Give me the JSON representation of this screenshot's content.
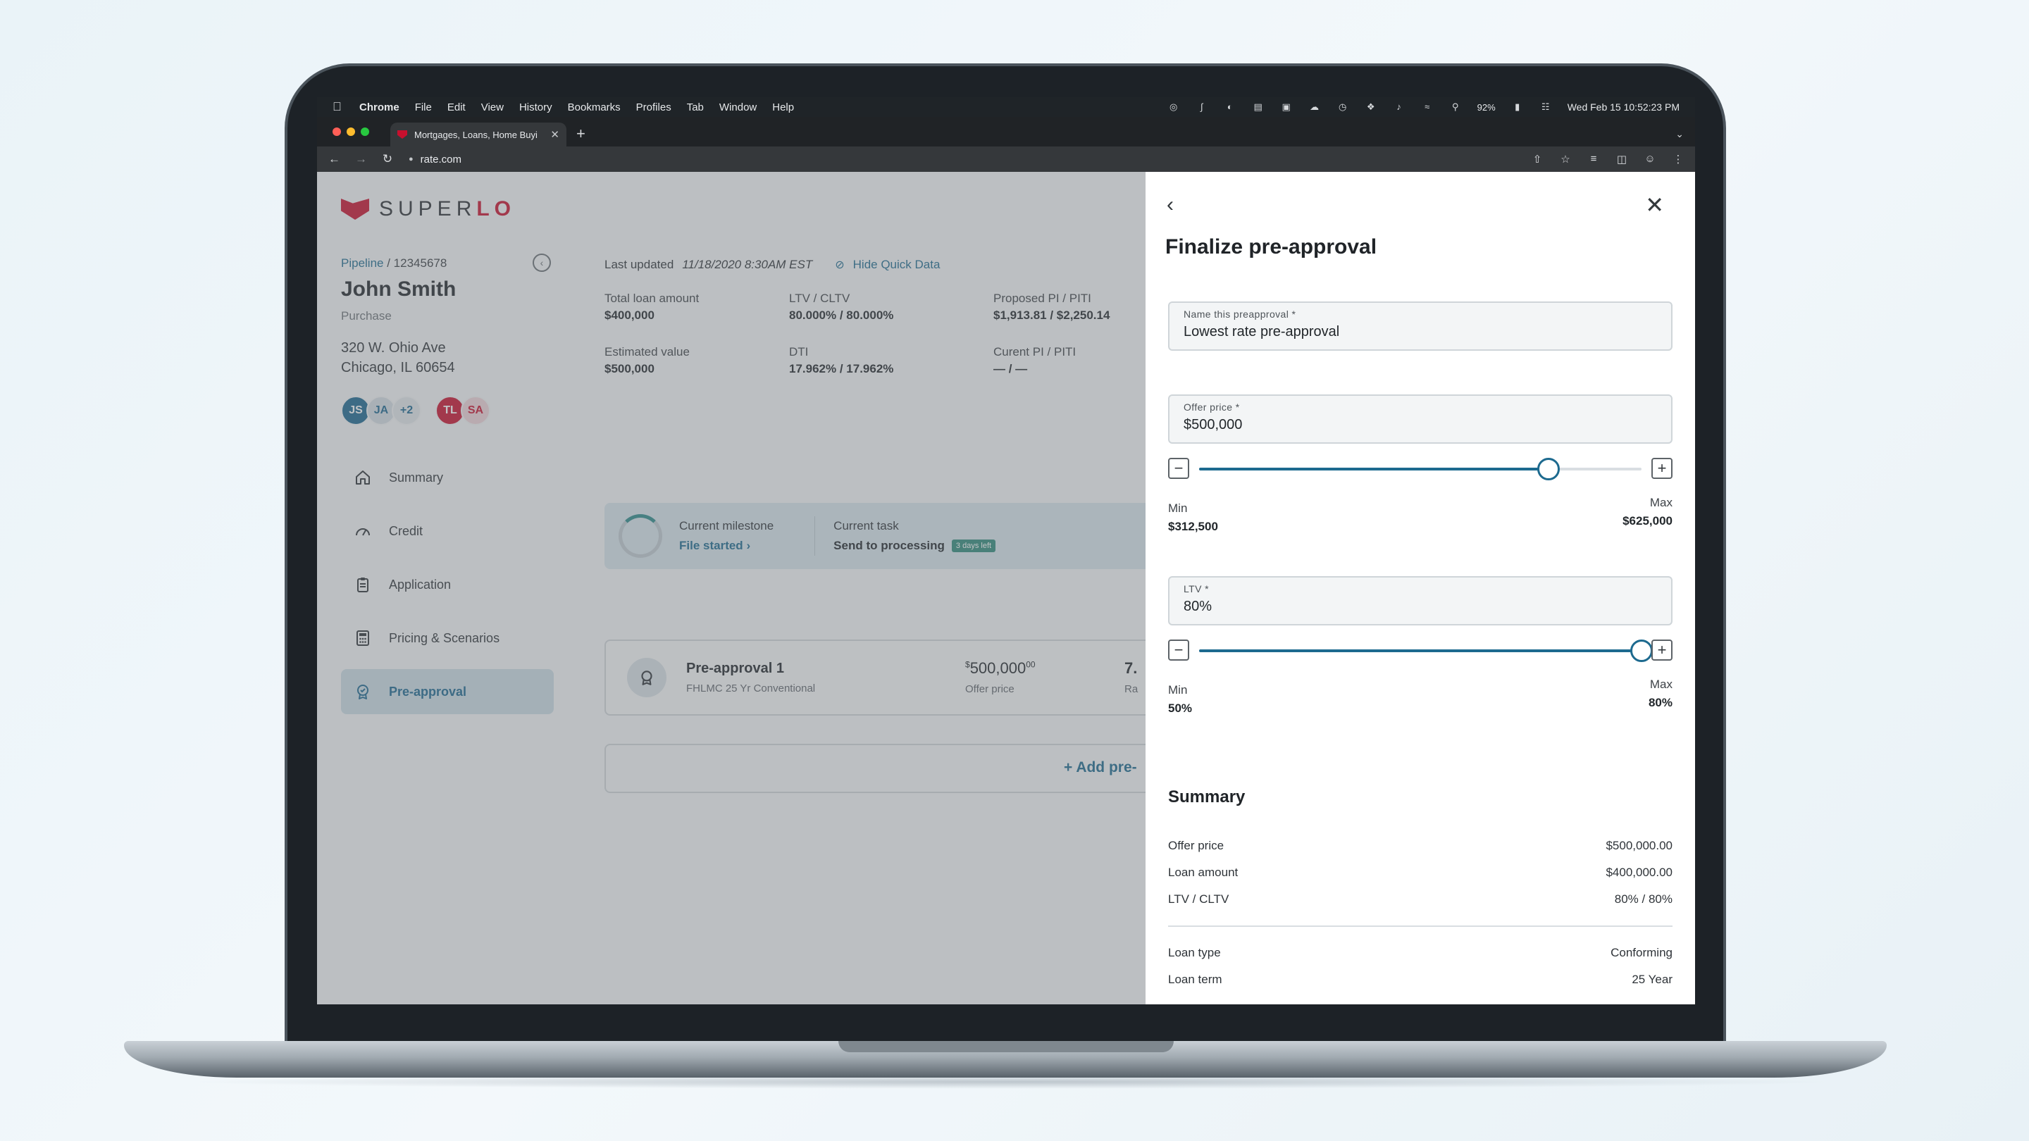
{
  "menubar": {
    "app": "Chrome",
    "items": [
      "File",
      "Edit",
      "View",
      "History",
      "Bookmarks",
      "Profiles",
      "Tab",
      "Window",
      "Help"
    ],
    "battery": "92%",
    "clock": "Wed Feb 15  10:52:23 PM"
  },
  "browser": {
    "tab_title": "Mortgages, Loans, Home Buyi",
    "url": "rate.com"
  },
  "app": {
    "logo_text_a": "SUPER",
    "logo_text_b": "LO",
    "breadcrumb_link": "Pipeline",
    "breadcrumb_sep": " / ",
    "loan_id": "12345678",
    "borrower_name": "John Smith",
    "loan_purpose": "Purchase",
    "address_line1": "320 W. Ohio Ave",
    "address_line2": "Chicago, IL 60654",
    "team": [
      "JS",
      "JA",
      "+2",
      "TL",
      "SA"
    ],
    "nav": [
      {
        "label": "Summary",
        "icon": "home-icon"
      },
      {
        "label": "Credit",
        "icon": "gauge-icon"
      },
      {
        "label": "Application",
        "icon": "clipboard-icon"
      },
      {
        "label": "Pricing & Scenarios",
        "icon": "calculator-icon"
      },
      {
        "label": "Pre-approval",
        "icon": "badge-icon",
        "active": true
      }
    ],
    "quick_data": {
      "last_updated_label": "Last updated",
      "last_updated_value": "11/18/2020 8:30AM EST",
      "hide_label": "Hide Quick Data",
      "items": [
        {
          "label": "Total loan amount",
          "value": "$400,000"
        },
        {
          "label": "LTV / CLTV",
          "value": "80.000% / 80.000%"
        },
        {
          "label": "Proposed PI / PITI",
          "value": "$1,913.81 / $2,250.14"
        },
        {
          "label": "Estimated value",
          "value": "$500,000"
        },
        {
          "label": "DTI",
          "value": "17.962% / 17.962%"
        },
        {
          "label": "Curent PI / PITI",
          "value": "— / —"
        }
      ]
    },
    "milestone": {
      "label": "Current milestone",
      "value": "File started",
      "task_label": "Current task",
      "task_value": "Send to processing",
      "task_badge": "3 days left"
    },
    "preapproval_card": {
      "title": "Pre-approval 1",
      "subtitle": "FHLMC 25 Yr Conventional",
      "price_symbol": "$",
      "price_main": "500,000",
      "price_cents": "00",
      "price_label": "Offer price",
      "trunc_value": "7.",
      "trunc_label": "Ra"
    },
    "add_label": "+ Add pre-"
  },
  "panel": {
    "title": "Finalize pre-approval",
    "name_field": {
      "label": "Name this preapproval *",
      "value": "Lowest rate pre-approval"
    },
    "offer_field": {
      "label": "Offer price *",
      "value": "$500,000"
    },
    "offer_slider": {
      "fraction": 0.79,
      "min_label": "Min",
      "min_value": "$312,500",
      "max_label": "Max",
      "max_value": "$625,000"
    },
    "ltv_field": {
      "label": "LTV *",
      "value": "80%"
    },
    "ltv_slider": {
      "fraction": 1.0,
      "min_label": "Min",
      "min_value": "50%",
      "max_label": "Max",
      "max_value": "80%"
    },
    "summary_title": "Summary",
    "summary_rows": [
      {
        "label": "Offer price",
        "value": "$500,000.00"
      },
      {
        "label": "Loan amount",
        "value": "$400,000.00"
      },
      {
        "label": "LTV / CLTV",
        "value": "80% / 80%"
      }
    ],
    "summary_rows_2": [
      {
        "label": "Loan type",
        "value": "Conforming"
      },
      {
        "label": "Loan term",
        "value": "25 Year"
      }
    ]
  },
  "colors": {
    "brand_red": "#c8102e",
    "brand_blue": "#1d6a8f",
    "success_teal": "#2f8b7b"
  }
}
